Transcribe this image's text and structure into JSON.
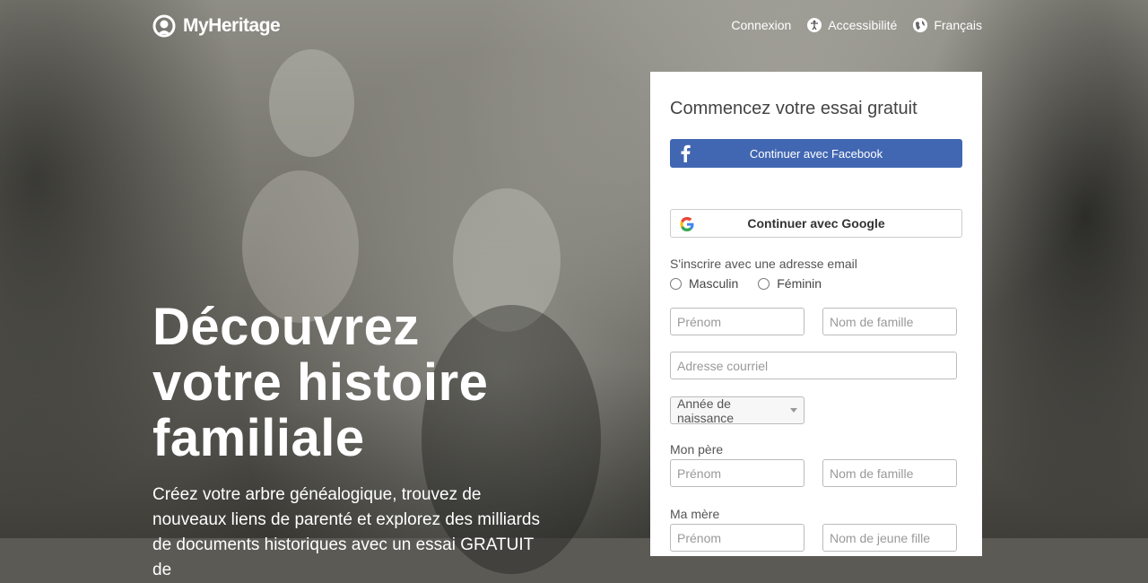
{
  "brand": {
    "name": "MyHeritage"
  },
  "nav": {
    "login": "Connexion",
    "accessibility": "Accessibilité",
    "language": "Français"
  },
  "hero": {
    "title_line1": "Découvrez",
    "title_line2": "votre histoire",
    "title_line3": "familiale",
    "subtitle": "Créez votre arbre généalogique, trouvez de nouveaux liens de parenté et explorez des milliards de documents historiques avec un essai GRATUIT de"
  },
  "signup": {
    "heading": "Commencez votre essai gratuit",
    "facebook_label": "Continuer avec Facebook",
    "google_label": "Continuer avec Google",
    "email_label": "S'inscrire avec une adresse email",
    "gender_male": "Masculin",
    "gender_female": "Féminin",
    "first_name_placeholder": "Prénom",
    "last_name_placeholder": "Nom de famille",
    "email_placeholder": "Adresse courriel",
    "birth_year": "Année de naissance",
    "father_label": "Mon père",
    "father_first_placeholder": "Prénom",
    "father_last_placeholder": "Nom de famille",
    "mother_label": "Ma mère",
    "mother_first_placeholder": "Prénom",
    "mother_last_placeholder": "Nom de jeune fille"
  },
  "colors": {
    "facebook": "#4267b2",
    "panel_bg": "#ffffff",
    "hero_text": "#ffffff"
  }
}
